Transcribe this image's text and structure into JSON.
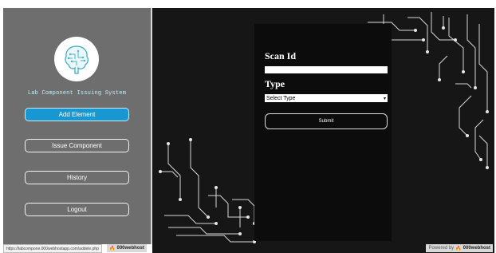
{
  "sidebar": {
    "app_title": "Lab Component Issuing System",
    "nav": [
      {
        "label": "Add Element",
        "active": true
      },
      {
        "label": "Issue Component",
        "active": false
      },
      {
        "label": "History",
        "active": false
      },
      {
        "label": "Logout",
        "active": false
      }
    ]
  },
  "form": {
    "scan_label": "Scan Id",
    "scan_value": "",
    "type_label": "Type",
    "type_selected": "Select Type",
    "submit_label": "Submit"
  },
  "footer": {
    "status_url": "https://labcompone.000webhostapp.com/addele.php",
    "badge_left_host": "000webhost",
    "badge_right_prefix": "Powered by",
    "badge_right_host": "000webhost"
  },
  "colors": {
    "sidebar_bg": "#6e6e6e",
    "active_button": "#1997d1",
    "main_bg": "#161616",
    "title_text": "#bff0ff"
  }
}
